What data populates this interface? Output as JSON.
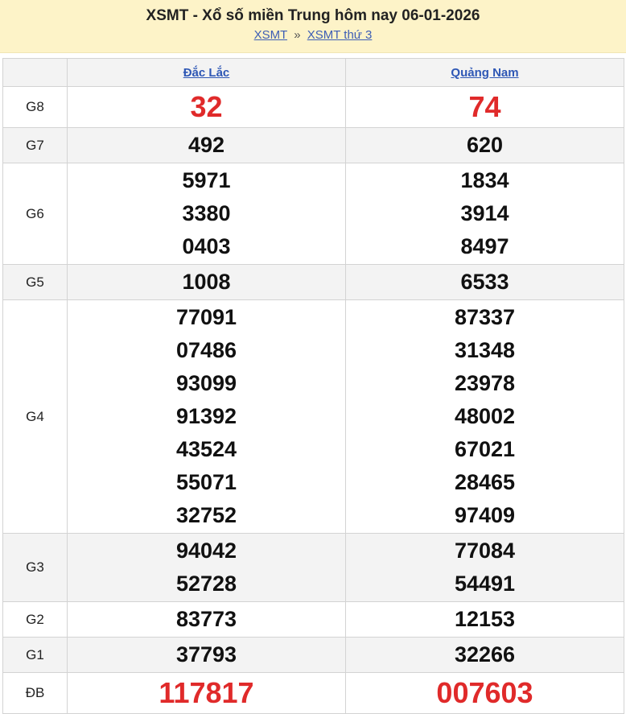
{
  "header": {
    "title": "XSMT - Xổ số miền Trung hôm nay 06-01-2026",
    "crumb1": "XSMT",
    "separator": "»",
    "crumb2": "XSMT thứ 3"
  },
  "provinces": [
    "Đắc Lắc",
    "Quảng Nam"
  ],
  "prizes": [
    {
      "label": "G8",
      "a": [
        "32"
      ],
      "b": [
        "74"
      ]
    },
    {
      "label": "G7",
      "a": [
        "492"
      ],
      "b": [
        "620"
      ]
    },
    {
      "label": "G6",
      "a": [
        "5971",
        "3380",
        "0403"
      ],
      "b": [
        "1834",
        "3914",
        "8497"
      ]
    },
    {
      "label": "G5",
      "a": [
        "1008"
      ],
      "b": [
        "6533"
      ]
    },
    {
      "label": "G4",
      "a": [
        "77091",
        "07486",
        "93099",
        "91392",
        "43524",
        "55071",
        "32752"
      ],
      "b": [
        "87337",
        "31348",
        "23978",
        "48002",
        "67021",
        "28465",
        "97409"
      ]
    },
    {
      "label": "G3",
      "a": [
        "94042",
        "52728"
      ],
      "b": [
        "77084",
        "54491"
      ]
    },
    {
      "label": "G2",
      "a": [
        "83773"
      ],
      "b": [
        "12153"
      ]
    },
    {
      "label": "G1",
      "a": [
        "37793"
      ],
      "b": [
        "32266"
      ]
    },
    {
      "label": "ĐB",
      "a": [
        "117817"
      ],
      "b": [
        "007603"
      ]
    }
  ],
  "colors": {
    "highlight": "#e02a2a",
    "header_bg": "#fdf3c8",
    "link": "#2e57b5"
  }
}
